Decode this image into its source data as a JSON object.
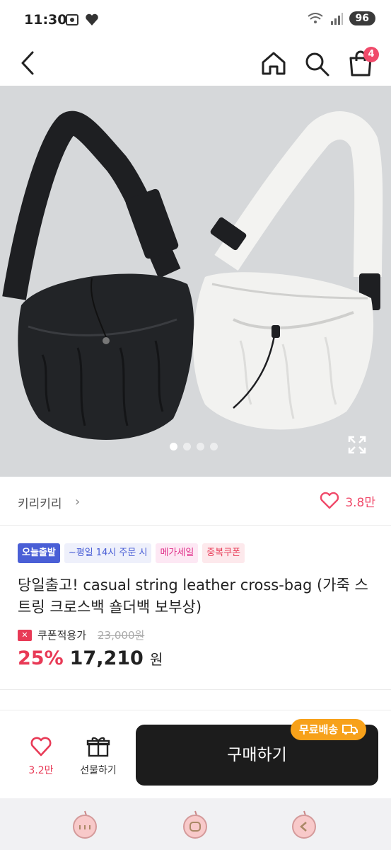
{
  "status_bar": {
    "time": "11:30",
    "battery": "96",
    "signal_label": "5"
  },
  "nav": {
    "cart_count": "4"
  },
  "gallery": {
    "page_count": 4,
    "active_index": 0
  },
  "brand": {
    "name": "키리키리",
    "arrow": "›",
    "like_count": "3.8만"
  },
  "product": {
    "tags": [
      "오늘출발",
      "~평일 14시 주문 시",
      "메가세일",
      "중복쿠폰"
    ],
    "title": "당일출고! casual string leather cross-bag (가죽 스트링 크로스백 숄더백 보부상)",
    "coupon_label": "쿠폰적용가",
    "original_price": "23,000원",
    "discount": "25%",
    "price": "17,210",
    "currency": "원"
  },
  "actions": {
    "like_count": "3.2만",
    "gift_label": "선물하기",
    "buy_label": "구매하기",
    "free_shipping_label": "무료배송"
  },
  "colors": {
    "accent": "#f04a6a",
    "sale_red": "#e83a56",
    "buy_button": "#1c1c1c",
    "free_shipping": "#f7a11a"
  }
}
